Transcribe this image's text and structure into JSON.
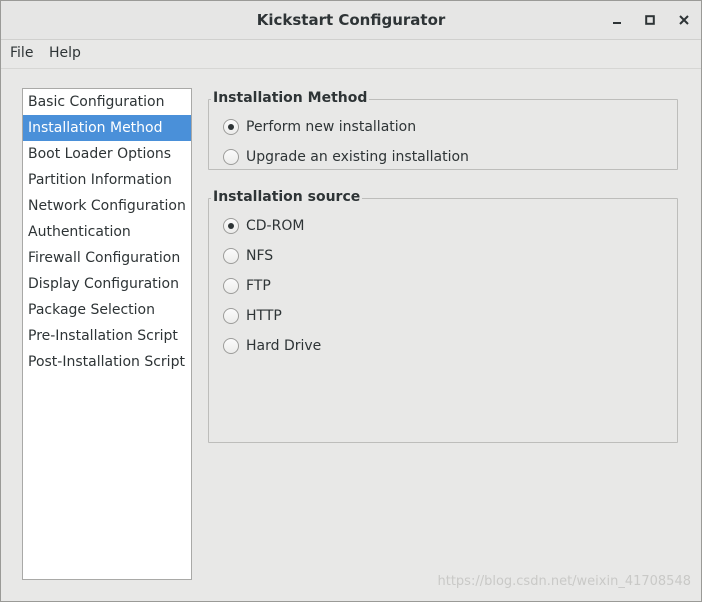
{
  "window": {
    "title": "Kickstart Configurator",
    "controls": {
      "minimize_icon": "minimize-icon",
      "maximize_icon": "maximize-icon",
      "close_icon": "close-icon"
    }
  },
  "menubar": {
    "items": [
      {
        "label": "File"
      },
      {
        "label": "Help"
      }
    ]
  },
  "sidebar": {
    "selected": "Installation Method",
    "items": [
      {
        "label": "Basic Configuration"
      },
      {
        "label": "Installation Method"
      },
      {
        "label": "Boot Loader Options"
      },
      {
        "label": "Partition Information"
      },
      {
        "label": "Network Configuration"
      },
      {
        "label": "Authentication"
      },
      {
        "label": "Firewall Configuration"
      },
      {
        "label": "Display Configuration"
      },
      {
        "label": "Package Selection"
      },
      {
        "label": "Pre-Installation Script"
      },
      {
        "label": "Post-Installation Script"
      }
    ]
  },
  "installation_method": {
    "legend": "Installation Method",
    "options": [
      {
        "label": "Perform new installation",
        "checked": true
      },
      {
        "label": "Upgrade an existing installation",
        "checked": false
      }
    ]
  },
  "installation_source": {
    "legend": "Installation source",
    "options": [
      {
        "label": "CD-ROM",
        "checked": true
      },
      {
        "label": "NFS",
        "checked": false
      },
      {
        "label": "FTP",
        "checked": false
      },
      {
        "label": "HTTP",
        "checked": false
      },
      {
        "label": "Hard Drive",
        "checked": false
      }
    ]
  },
  "watermark": "https://blog.csdn.net/weixin_41708548",
  "colors": {
    "selection": "#4a90d9",
    "background": "#e8e8e7",
    "text": "#2e3436"
  }
}
